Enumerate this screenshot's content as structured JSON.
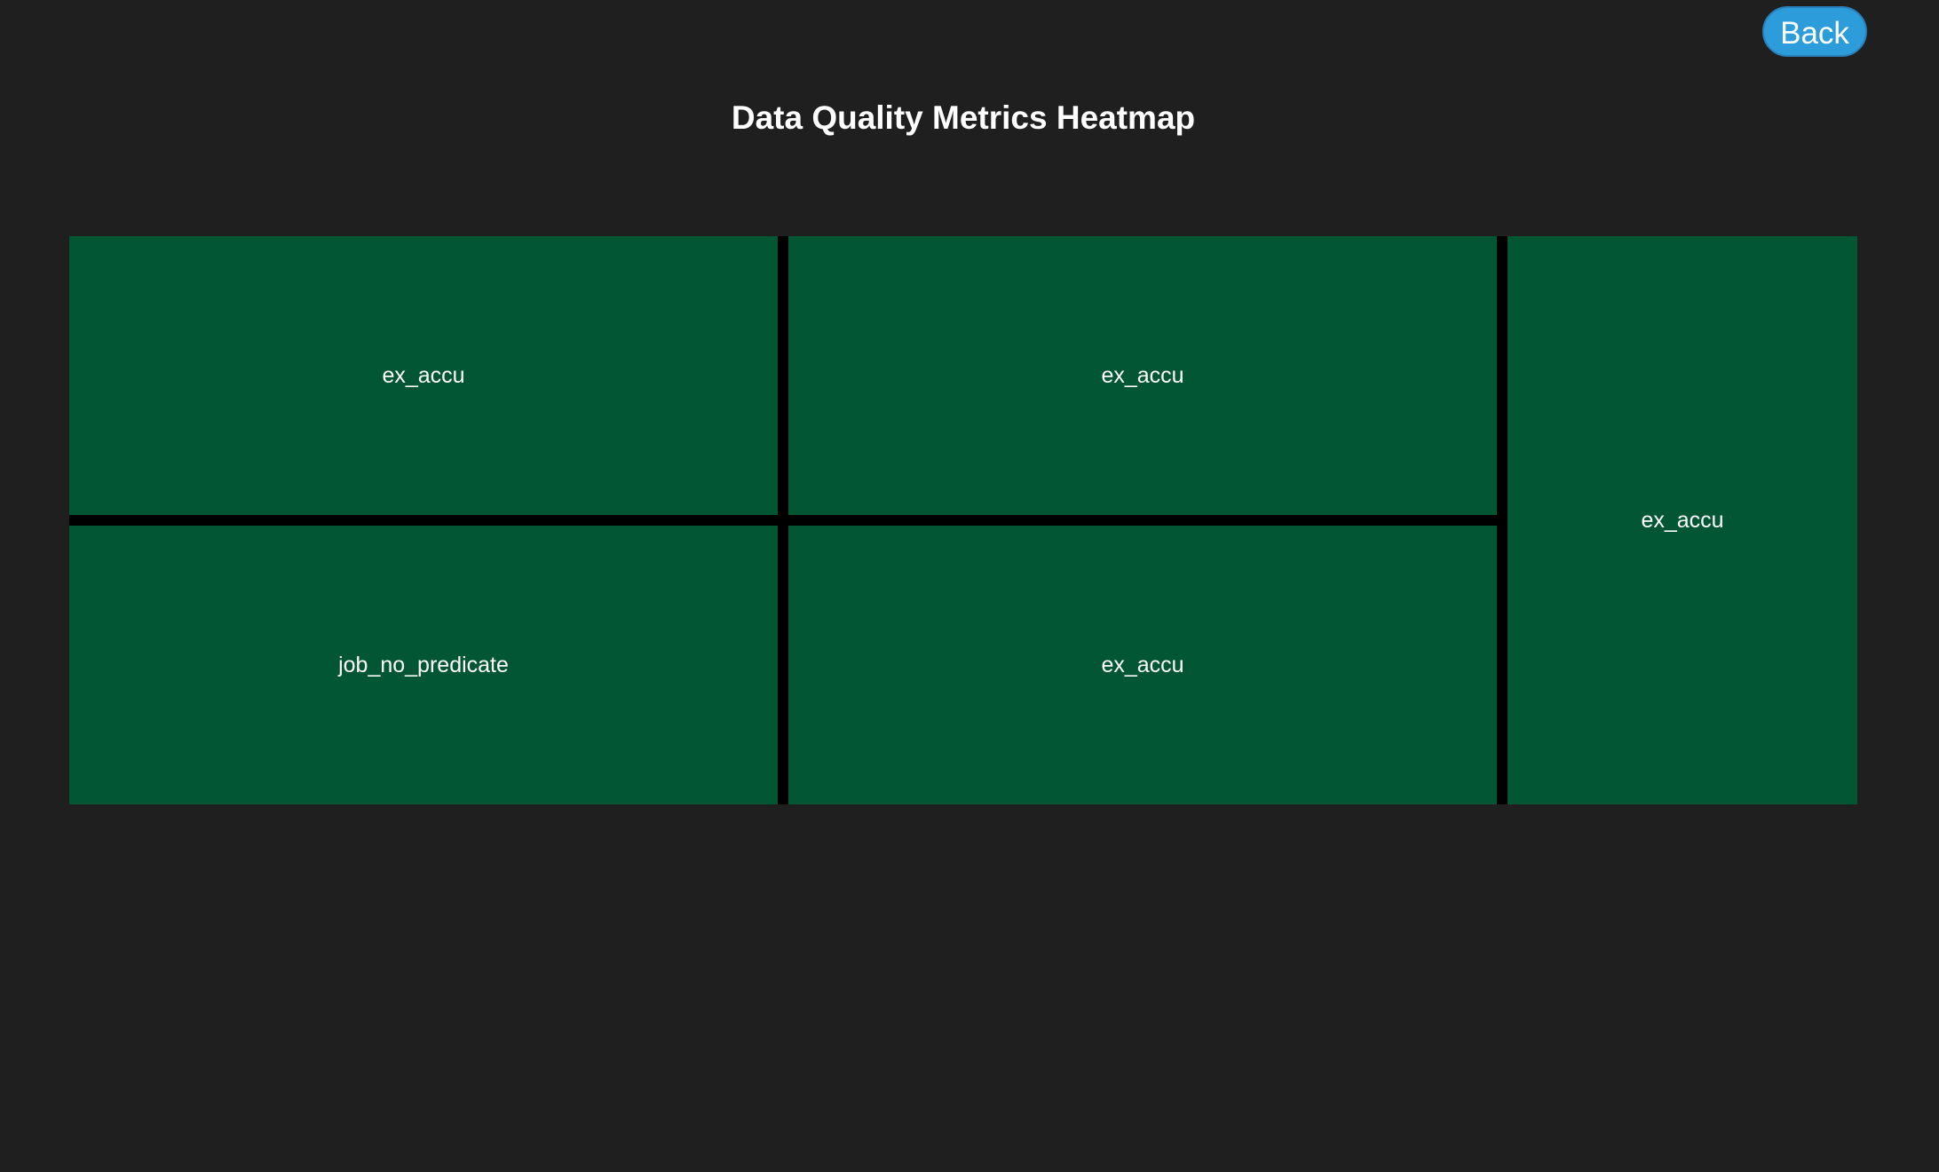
{
  "header": {
    "back_label": "Back",
    "title": "Data Quality Metrics Heatmap"
  },
  "heatmap": {
    "cells": [
      {
        "label": "ex_accu",
        "color": "#025633"
      },
      {
        "label": "job_no_predicate",
        "color": "#025633"
      },
      {
        "label": "ex_accu",
        "color": "#025633"
      },
      {
        "label": "ex_accu",
        "color": "#025633"
      },
      {
        "label": "ex_accu",
        "color": "#025633"
      }
    ],
    "divider_color": "#000000"
  },
  "colors": {
    "background": "#1f1f1f",
    "accent": "#2d9cdb",
    "text": "#ffffff"
  }
}
